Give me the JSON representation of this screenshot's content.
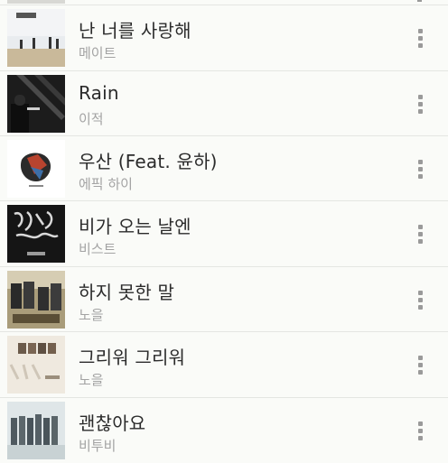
{
  "songs": [
    {
      "title": "난 너를 사랑해",
      "artist": "메이트",
      "menu_icon": "more-vertical-icon"
    },
    {
      "title": "Rain",
      "artist": "이적",
      "menu_icon": "more-vertical-icon"
    },
    {
      "title": "우산 (Feat. 윤하)",
      "artist": "에픽 하이",
      "menu_icon": "more-vertical-icon"
    },
    {
      "title": "비가 오는 날엔",
      "artist": "비스트",
      "menu_icon": "more-vertical-icon"
    },
    {
      "title": "하지 못한 말",
      "artist": "노을",
      "menu_icon": "more-vertical-icon"
    },
    {
      "title": "그리워 그리워",
      "artist": "노을",
      "menu_icon": "more-vertical-icon"
    },
    {
      "title": "괜찮아요",
      "artist": "비투비",
      "menu_icon": "more-vertical-icon"
    }
  ]
}
